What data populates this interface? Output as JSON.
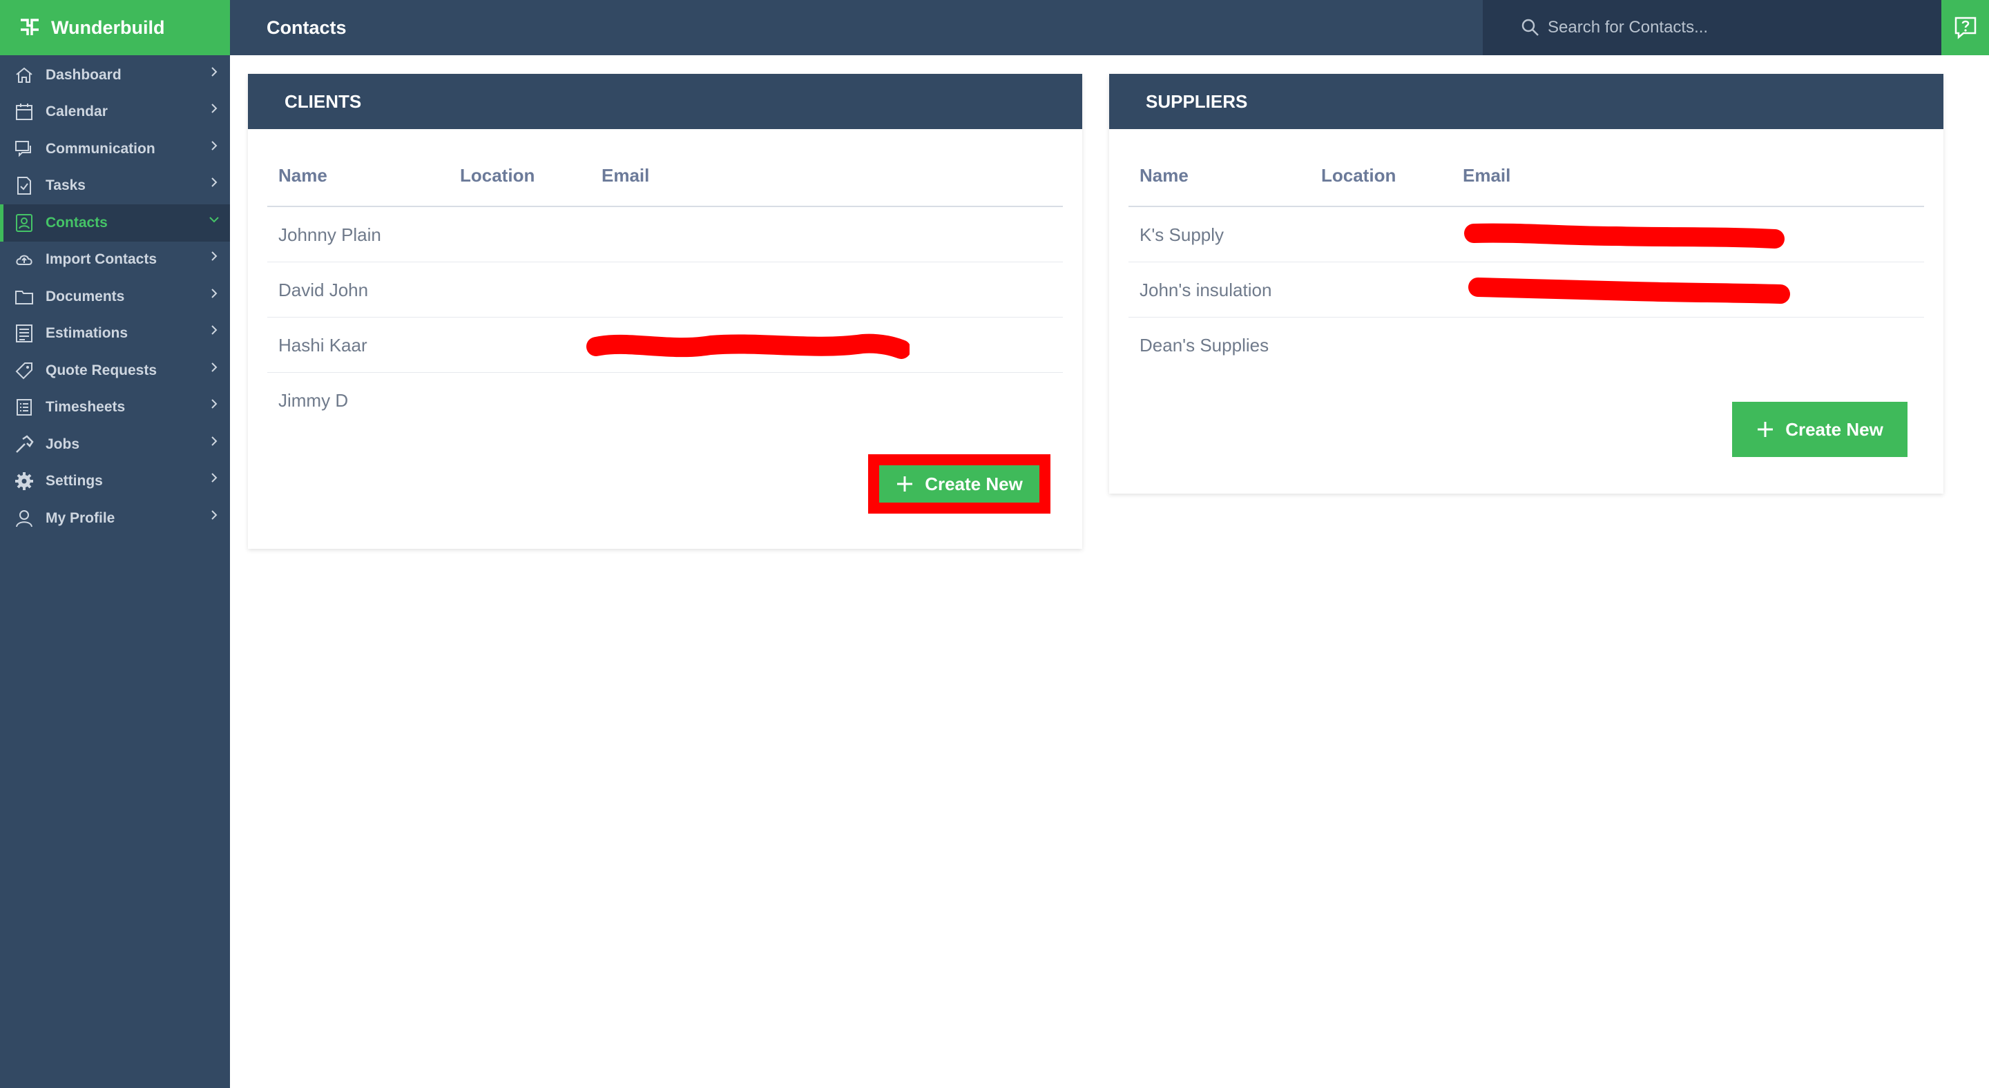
{
  "app": {
    "brand": "Wunderbuild",
    "page_title": "Contacts",
    "colors": {
      "navy": "#334963",
      "navy_dark": "#263850",
      "green": "#3fba5a",
      "annotation_red": "#ff0000"
    }
  },
  "sidebar": {
    "items": [
      {
        "label": "Dashboard",
        "icon": "home-icon"
      },
      {
        "label": "Calendar",
        "icon": "calendar-icon"
      },
      {
        "label": "Communication",
        "icon": "chat-icon"
      },
      {
        "label": "Tasks",
        "icon": "task-icon"
      },
      {
        "label": "Contacts",
        "icon": "contact-icon",
        "active": true
      },
      {
        "label": "Import Contacts",
        "icon": "cloud-upload-icon"
      },
      {
        "label": "Documents",
        "icon": "folder-icon"
      },
      {
        "label": "Estimations",
        "icon": "estimation-icon"
      },
      {
        "label": "Quote Requests",
        "icon": "tag-icon"
      },
      {
        "label": "Timesheets",
        "icon": "timesheet-icon"
      },
      {
        "label": "Jobs",
        "icon": "hammer-icon"
      },
      {
        "label": "Settings",
        "icon": "gear-icon"
      },
      {
        "label": "My Profile",
        "icon": "user-icon"
      }
    ]
  },
  "search": {
    "placeholder": "Search for Contacts..."
  },
  "clients": {
    "title": "CLIENTS",
    "columns": [
      "Name",
      "Location",
      "Email"
    ],
    "rows": [
      {
        "name": "Johnny Plain",
        "email_redacted": false
      },
      {
        "name": "David John",
        "email_redacted": false
      },
      {
        "name": "Hashi Kaar",
        "email_redacted": true
      },
      {
        "name": "Jimmy D",
        "email_redacted": false
      }
    ],
    "create_label": "Create New"
  },
  "suppliers": {
    "title": "SUPPLIERS",
    "columns": [
      "Name",
      "Location",
      "Email"
    ],
    "rows": [
      {
        "name": "K's Supply",
        "email_redacted": true
      },
      {
        "name": "John's insulation",
        "email_redacted": true
      },
      {
        "name": "Dean's Supplies",
        "email_redacted": false
      }
    ],
    "create_label": "Create New"
  }
}
